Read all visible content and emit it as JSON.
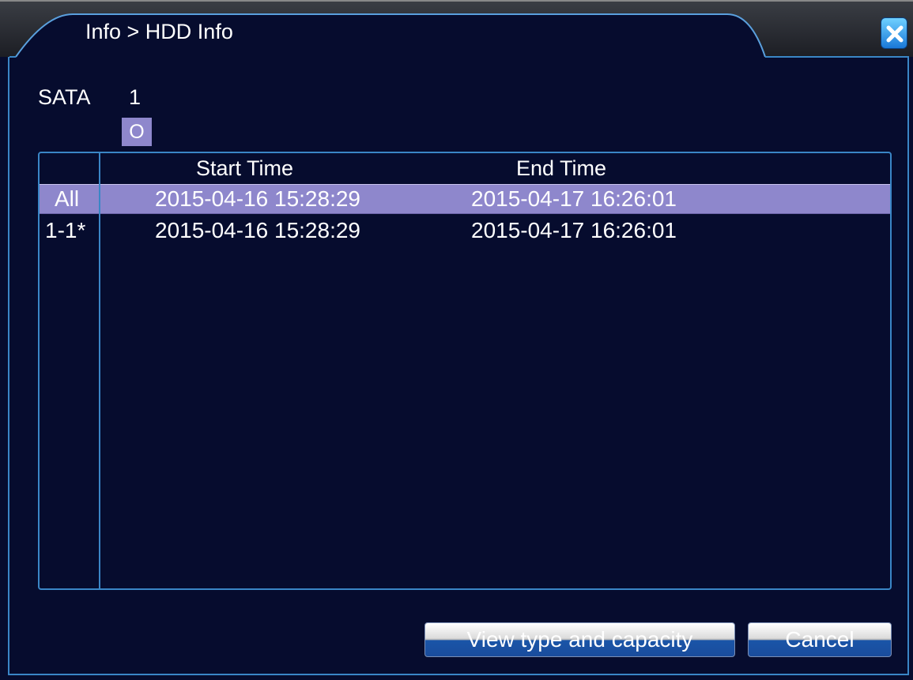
{
  "window": {
    "title": "Info > HDD Info"
  },
  "disk": {
    "type_label": "SATA",
    "number": "1",
    "status": "O"
  },
  "table": {
    "headers": [
      "Start Time",
      "End Time"
    ],
    "rows": [
      {
        "id": "All",
        "start": "2015-04-16 15:28:29",
        "end": "2015-04-17 16:26:01",
        "selected": true
      },
      {
        "id": "1-1*",
        "start": "2015-04-16 15:28:29",
        "end": "2015-04-17 16:26:01",
        "selected": false
      }
    ]
  },
  "buttons": {
    "view": "View type and capacity",
    "cancel": "Cancel"
  },
  "colors": {
    "background": "#060c2e",
    "border": "#3a86c6",
    "highlight": "#8e87cc"
  },
  "icons": {
    "close": "close-icon"
  }
}
